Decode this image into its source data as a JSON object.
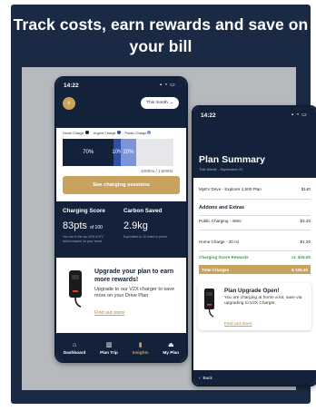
{
  "headline": "Track costs, earn rewards and save on your bill",
  "colors": {
    "navy": "#14213b",
    "gold": "#c9a35d",
    "home": "#14213b",
    "urgent": "#2d4fa6",
    "public": "#7c95d8",
    "green": "#3a9a4a"
  },
  "phone1": {
    "status": {
      "time": "14:22",
      "icons": "signal-wifi-battery-icons"
    },
    "month_selector": "This month",
    "legend": {
      "home": "Home Charge",
      "urgent": "Urgent Charge",
      "public": "Public Charge"
    },
    "usage_bar": {
      "home_pct": 70,
      "urgent_pct": 10,
      "public_pct": 20,
      "home_label": "70%",
      "urgent_label": "10%",
      "public_label": "20%"
    },
    "mileage": "1000mi / 1,500mi",
    "sessions_button": "See charging sessions",
    "charging_score": {
      "title": "Charging Score",
      "value": "83pts",
      "suffix": "of 100",
      "note": "You are in the top 10% of EV drivers based on your score"
    },
    "carbon_saved": {
      "title": "Carbon Saved",
      "value": "2.9kg",
      "note": "Equivalent to 10 miles in petrol"
    },
    "upgrade_card": {
      "title": "Upgrade your plan to earn more rewards!",
      "body": "Upgrade to our V2X charger to save more on your Drive Plan",
      "link": "Find out more"
    },
    "tabs": [
      {
        "label": "Dashboard",
        "icon": "home-icon"
      },
      {
        "label": "Plan Trip",
        "icon": "map-icon"
      },
      {
        "label": "Insights",
        "icon": "chart-icon"
      },
      {
        "label": "My Plan",
        "icon": "car-icon"
      }
    ]
  },
  "phone2": {
    "status": {
      "time": "14:22"
    },
    "title": "Plan Summary",
    "subtitle": "This Month - September 22",
    "plan": {
      "name": "MyEV Drive - Explorer 1,500 Plan",
      "price": "$140"
    },
    "addons_title": "Addons and Extras",
    "addons": [
      {
        "label": "Public Charging - 49mi",
        "value": "$3.20"
      },
      {
        "label": "Home Charge - 20 mi",
        "value": "$1.20"
      }
    ],
    "rewards": {
      "label": "Charging Score Rewards",
      "value": "cr. $15.00"
    },
    "total": {
      "label": "Total Charges",
      "value": "$ 129.40"
    },
    "card": {
      "title": "Plan Upgrade Open!",
      "body": "You are charging at home a lot, save via upgrading to V2X Charger.",
      "link": "Find out more"
    },
    "back": "Back"
  }
}
